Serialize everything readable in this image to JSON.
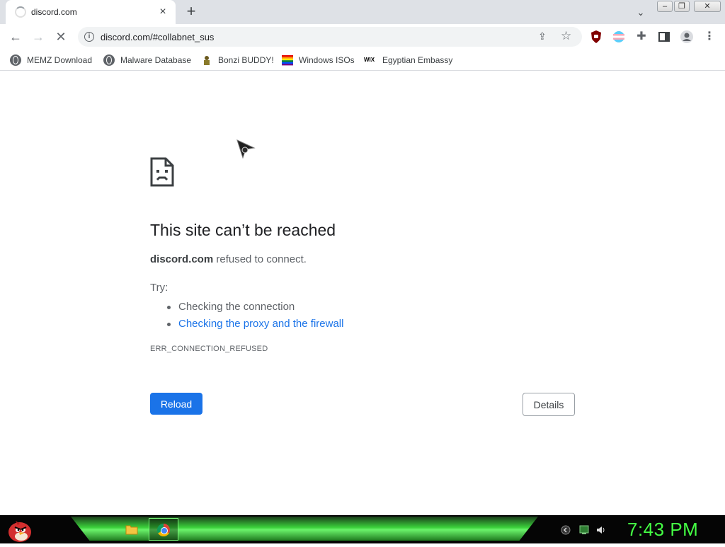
{
  "tab": {
    "title": "discord.com",
    "close": "×",
    "new_tab": "+"
  },
  "tab_search": "⌄",
  "window": {
    "minimize": "–",
    "maximize": "❐",
    "close": "✕"
  },
  "toolbar": {
    "back": "←",
    "forward": "→",
    "stop": "✕",
    "url": "discord.com/#collabnet_sus",
    "info_glyph": "i",
    "share": "⇪",
    "star": "☆",
    "puzzle": "✚",
    "menu": "⋮"
  },
  "bookmarks": [
    {
      "label": "MEMZ Download",
      "icon": "globe-icon"
    },
    {
      "label": "Malware Database",
      "icon": "globe-icon"
    },
    {
      "label": "Bonzi BUDDY!",
      "icon": "bonzi-icon"
    },
    {
      "label": "Windows ISOs",
      "icon": "rainbow-flag-icon"
    },
    {
      "label": "Egyptian Embassy",
      "icon": "wix-icon",
      "icon_text": "WIX"
    }
  ],
  "error": {
    "title": "This site can’t be reached",
    "host": "discord.com",
    "desc_rest": " refused to connect.",
    "try_label": "Try:",
    "suggestions": [
      "Checking the connection",
      "Checking the proxy and the firewall"
    ],
    "code": "ERR_CONNECTION_REFUSED",
    "reload_label": "Reload",
    "details_label": "Details"
  },
  "taskbar": {
    "clock": "7:43 PM"
  },
  "colors": {
    "accent": "#1a73e8",
    "clock": "#44ff44",
    "taskbar_glow": "#3bd03b"
  }
}
